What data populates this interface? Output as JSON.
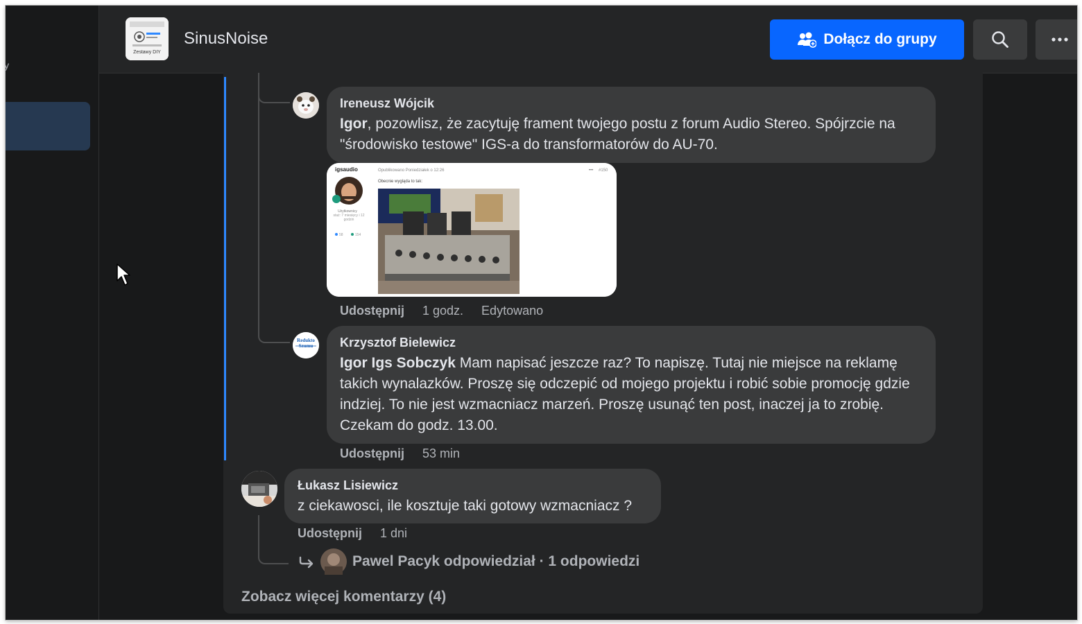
{
  "window": {
    "left_stray_text": "y"
  },
  "group": {
    "name": "SinusNoise",
    "avatar_text": "Zestawy DIY"
  },
  "header": {
    "join_label": "Dołącz do grupy"
  },
  "comments": [
    {
      "author": "Ireneusz Wójcik",
      "mention": "Igor",
      "text": ", pozowlisz, że zacytuję frament twojego postu z forum Audio Stereo. Spójrzcie na \"środowisko testowe\" IGS-a do transformatorów do AU-70.",
      "share": "Udostępnij",
      "time": "1 godz.",
      "edited": "Edytowano",
      "attachment": {
        "user": "igsaudio",
        "posted": "Opublikowano Poniedziałek o 12:26",
        "post_number": "#150",
        "post_text": "Obecnie wygląda to tak:",
        "role": "Użytkownicy",
        "tenure": "staż: 7 miesięcy i 12 godzin",
        "stat_posts": "58",
        "stat_rep": "154"
      }
    },
    {
      "author": "Krzysztof Bielewicz",
      "avatar_text": "Redukto Szumu",
      "mention": "Igor Igs Sobczyk",
      "text": " Mam napisać jeszcze raz? To napiszę. Tutaj nie miejsce na reklamę takich wynalazków. Proszę się odczepić od mojego projektu i robić sobie promocję gdzie indziej. To nie jest wzmacniacz marzeń. Proszę usunąć ten post, inaczej ja to zrobię. Czekam do godz. 13.00.",
      "share": "Udostępnij",
      "time": "53 min"
    },
    {
      "author": "Łukasz Lisiewicz",
      "text": "z ciekawosci, ile kosztuje taki gotowy wzmacniacz ?",
      "share": "Udostępnij",
      "time": "1 dni"
    }
  ],
  "replies": {
    "label": "Pawel Pacyk odpowiedział · 1 odpowiedzi"
  },
  "more_comments": {
    "label": "Zobacz więcej komentarzy (4)"
  },
  "colors": {
    "accent": "#0866ff",
    "thread": "#2d88ff",
    "bubble": "#3a3b3c",
    "background": "#18191a",
    "card": "#242526"
  },
  "icons": [
    "group-join-icon",
    "search-icon",
    "more-icon",
    "reply-arrow-icon",
    "cursor-icon"
  ]
}
